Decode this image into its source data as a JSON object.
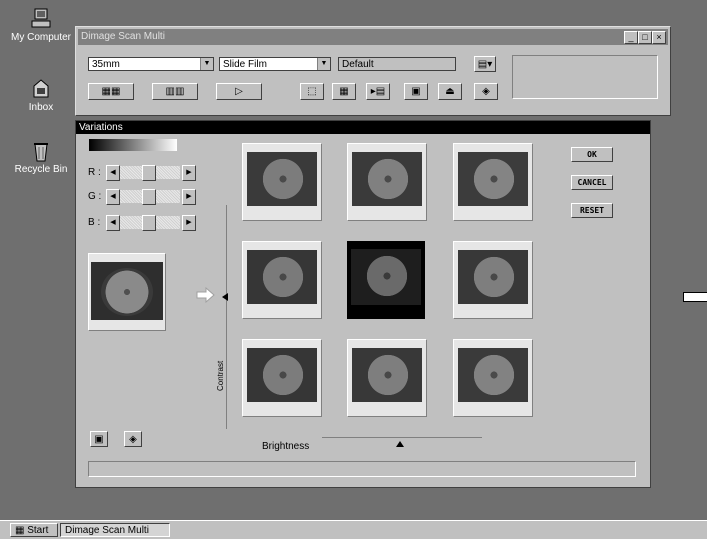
{
  "desktop": {
    "icons": [
      {
        "label": "My Computer",
        "icon": "computer-icon"
      },
      {
        "label": "Inbox",
        "icon": "inbox-icon"
      },
      {
        "label": "Recycle Bin",
        "icon": "recycle-bin-icon"
      }
    ]
  },
  "main_window": {
    "title": "Dimage Scan Multi",
    "film_format": "35mm",
    "film_type": "Slide Film",
    "setting": "Default",
    "window_buttons": {
      "minimize": "_",
      "maximize": "□",
      "close": "×"
    }
  },
  "variations": {
    "title": "Variations",
    "slider_labels": {
      "r": "R :",
      "g": "G :",
      "b": "B :"
    },
    "slider_arrows": {
      "left": "◀",
      "right": "▶"
    },
    "buttons": {
      "ok": "OK",
      "cancel": "CANCEL",
      "reset": "RESET"
    },
    "contrast_label": "Contrast",
    "brightness_label": "Brightness",
    "status_text": ""
  },
  "taskbar": {
    "start_label": "Start",
    "task_label": "Dimage Scan Multi"
  },
  "colors": {
    "desktop_bg": "#6f6f6f",
    "dialog_bg": "#c0c0c0",
    "titlebar_active": "#000000",
    "titlebar_inactive": "#808080"
  }
}
